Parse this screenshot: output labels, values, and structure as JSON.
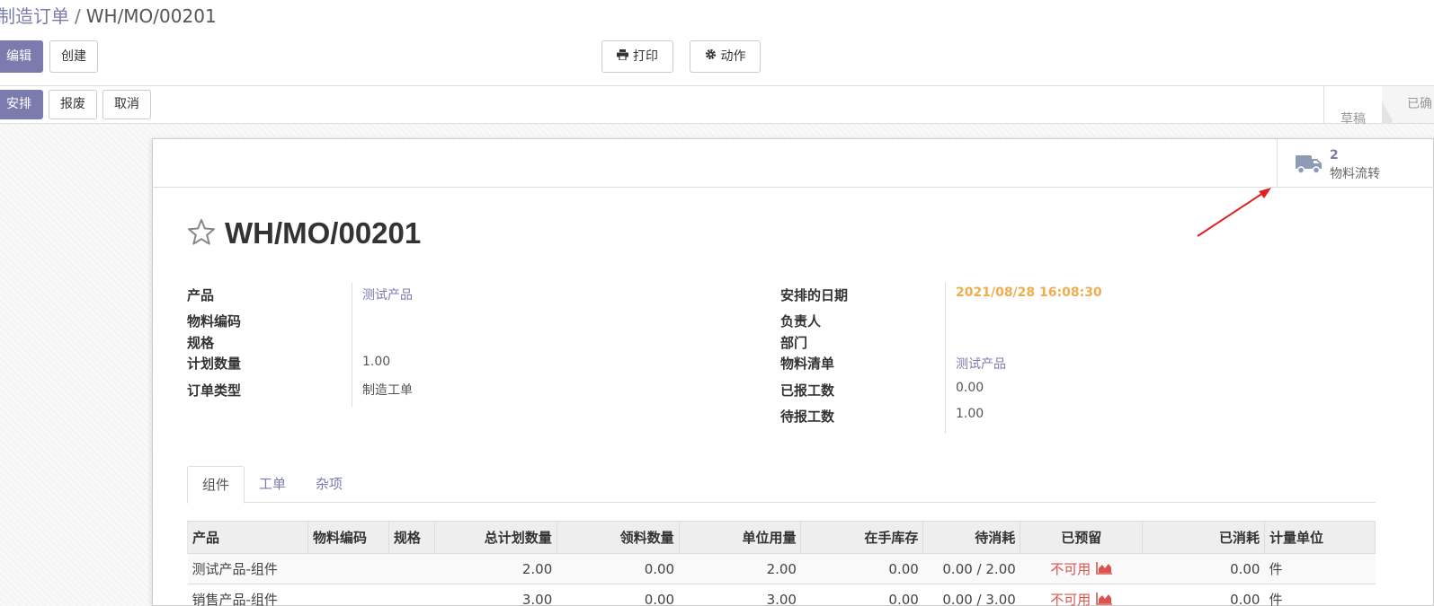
{
  "breadcrumb": {
    "parent": "制造订单",
    "separator": "/",
    "current": "WH/MO/00201"
  },
  "toolbar": {
    "edit": "编辑",
    "create": "创建",
    "print": "打印",
    "action": "动作"
  },
  "statusbar": {
    "plan": "安排",
    "scrap": "报废",
    "cancel": "取消",
    "stages": [
      "草稿",
      "已确"
    ]
  },
  "smart_button": {
    "count": "2",
    "label": "物料流转",
    "icon": "truck-icon"
  },
  "record": {
    "name": "WH/MO/00201",
    "starred": false
  },
  "fields_left": [
    {
      "label": "产品",
      "value": "测试产品",
      "link": true
    },
    {
      "label": "物料编码",
      "value": ""
    },
    {
      "label": "规格",
      "value": ""
    },
    {
      "label": "计划数量",
      "value": "1.00"
    },
    {
      "label": "订单类型",
      "value": "制造工单"
    }
  ],
  "fields_right": [
    {
      "label": "安排的日期",
      "value": "2021/08/28 16:08:30",
      "warn": true
    },
    {
      "label": "负责人",
      "value": ""
    },
    {
      "label": "部门",
      "value": ""
    },
    {
      "label": "物料清单",
      "value": "测试产品",
      "link": true
    },
    {
      "label": "已报工数",
      "value": "0.00"
    },
    {
      "label": "待报工数",
      "value": "1.00"
    }
  ],
  "tabs": [
    "组件",
    "工单",
    "杂项"
  ],
  "table": {
    "headers": [
      "产品",
      "物料编码",
      "规格",
      "总计划数量",
      "领料数量",
      "单位用量",
      "在手库存",
      "待消耗",
      "已预留",
      "已消耗",
      "计量单位"
    ],
    "rows": [
      [
        "测试产品-组件",
        "",
        "",
        "2.00",
        "0.00",
        "2.00",
        "0.00",
        "0.00 / 2.00",
        "不可用",
        "0.00",
        "件"
      ],
      [
        "销售产品-组件",
        "",
        "",
        "3.00",
        "0.00",
        "3.00",
        "0.00",
        "0.00 / 3.00",
        "不可用",
        "0.00",
        "件"
      ]
    ]
  },
  "colors": {
    "accent": "#7c7bad",
    "warning": "#f0ad4e",
    "danger": "#d9534f",
    "success": "#28a745",
    "arrow": "#e02020"
  }
}
